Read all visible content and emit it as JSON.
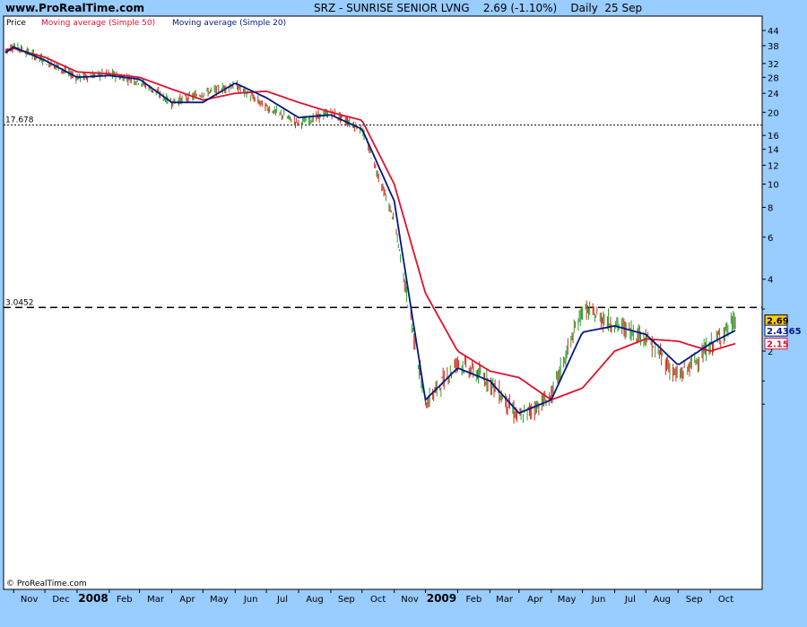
{
  "header": {
    "site": "www.ProRealTime.com",
    "title": "SRZ - SUNRISE SENIOR LVNG    2.69 (-1.10%)    Daily  25 Sep"
  },
  "legend": {
    "price": "Price",
    "ma50": "Moving average (Simple 50)",
    "ma20": "Moving average (Simple 20)"
  },
  "watermark": "© ProRealTime.com",
  "colors": {
    "background": "#99ccff",
    "plot_background": "#ffffff",
    "ma50": "#e0102e",
    "ma20": "#001a80",
    "candle_up": "#2da02d",
    "candle_down": "#c8321e",
    "level_label_bg": "#ffcc00"
  },
  "chart_data": {
    "type": "line",
    "scale": "log",
    "ylim": [
      0.78,
      50
    ],
    "y_ticks": [
      44,
      38,
      32,
      28,
      24,
      20,
      16,
      14,
      12,
      10,
      8,
      6,
      4,
      2
    ],
    "x_tick_labels": [
      "Nov",
      "Dec",
      "2008",
      "Feb",
      "Mar",
      "Apr",
      "May",
      "Jun",
      "Jul",
      "Aug",
      "Sep",
      "Oct",
      "Nov",
      "2009",
      "Feb",
      "Mar",
      "Apr",
      "May",
      "Jun",
      "Jul",
      "Aug",
      "Sep",
      "Oct"
    ],
    "x": [
      "Oct 24",
      "Nov 1",
      "Dec 1",
      "Jan 1",
      "Feb 1",
      "Mar 1",
      "Apr 1",
      "May 1",
      "Jun 1",
      "Jul 1",
      "Aug 1",
      "Sep 1",
      "Oct 1",
      "Nov 1",
      "Dec 1",
      "Jan 1",
      "Feb 1",
      "Mar 1",
      "Apr 1",
      "May 1",
      "Jun 1",
      "Jul 1",
      "Aug 1",
      "Sep 1",
      "Sep 25"
    ],
    "series": [
      {
        "name": "Price",
        "values": [
          36,
          38,
          33,
          28,
          29,
          27,
          22,
          24,
          26,
          21,
          18,
          20,
          17,
          7,
          1.2,
          1.8,
          1.5,
          1.05,
          1.3,
          3.0,
          2.6,
          2.3,
          1.55,
          2.1,
          2.69
        ]
      },
      {
        "name": "Moving average (Simple 20)",
        "values": [
          35.5,
          37.5,
          33,
          28,
          28.5,
          27.5,
          22,
          22,
          26.5,
          23,
          19,
          19.5,
          17,
          8.5,
          1.25,
          1.7,
          1.5,
          1.1,
          1.25,
          2.4,
          2.55,
          2.35,
          1.75,
          2.15,
          2.44
        ]
      },
      {
        "name": "Moving average (Simple 50)",
        "values": [
          36.5,
          37,
          34,
          29.5,
          29,
          28,
          25,
          22.5,
          24,
          24.5,
          22,
          20,
          18.5,
          10,
          3.5,
          2.0,
          1.65,
          1.55,
          1.25,
          1.4,
          2.0,
          2.25,
          2.2,
          2.0,
          2.15
        ]
      }
    ],
    "levels": [
      {
        "label": "17.678",
        "value": 17.678,
        "style": "dotted"
      },
      {
        "label": "3.0452",
        "value": 3.0452,
        "style": "dashed"
      }
    ],
    "last_values": [
      {
        "label": "2.69",
        "value": 2.69
      },
      {
        "label": "2.4365",
        "value": 2.4365
      },
      {
        "label": "2.15",
        "value": 2.15
      }
    ]
  }
}
